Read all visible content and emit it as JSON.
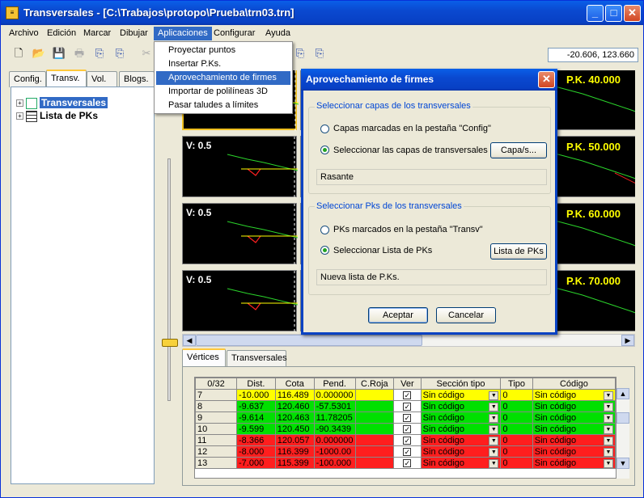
{
  "window": {
    "title": "Transversales - [C:\\Trabajos\\protopo\\Prueba\\trn03.trn]",
    "minimize_label": "_",
    "maximize_label": "□",
    "close_label": "✕",
    "app_icon": "≡"
  },
  "menubar": {
    "items": [
      "Archivo",
      "Edición",
      "Marcar",
      "Dibujar",
      "Aplicaciones",
      "Configurar",
      "Ayuda"
    ]
  },
  "toolbar": {
    "coordinates": "-20.606, 123.660"
  },
  "left_tabs": [
    "Config.",
    "Transv.",
    "Vol.",
    "Blogs."
  ],
  "tree": {
    "items": [
      "Transversales",
      "Lista de PKs"
    ],
    "expander": "+"
  },
  "graphs": {
    "rows": [
      {
        "v": "V: 0.5",
        "pk": "P.K. 40.000"
      },
      {
        "v": "V: 0.5",
        "pk": "P.K. 50.000"
      },
      {
        "v": "V: 0.5",
        "pk": "P.K. 60.000"
      },
      {
        "v": "V: 0.5",
        "pk": "P.K. 70.000"
      }
    ]
  },
  "bottom_tabs": [
    "Vértices",
    "Transversales"
  ],
  "grid": {
    "headers": [
      "0/32",
      "Dist.",
      "Cota",
      "Pend.",
      "C.Roja",
      "Ver",
      "Sección tipo",
      "Tipo",
      "Código"
    ],
    "check_mark": "✓",
    "rows": [
      {
        "n": "7",
        "dist": "-10.000",
        "cota": "116.489",
        "pend": "0.000000",
        "roja": "",
        "ver": true,
        "seccion": "Sin código",
        "tipo": "0",
        "codigo": "Sin código",
        "color": "#ffff00"
      },
      {
        "n": "8",
        "dist": "-9.637",
        "cota": "120.460",
        "pend": "-57.5301",
        "roja": "",
        "ver": true,
        "seccion": "Sin código",
        "tipo": "0",
        "codigo": "Sin código",
        "color": "#00e000"
      },
      {
        "n": "9",
        "dist": "-9.614",
        "cota": "120.463",
        "pend": "11.78205",
        "roja": "",
        "ver": true,
        "seccion": "Sin código",
        "tipo": "0",
        "codigo": "Sin código",
        "color": "#00e000"
      },
      {
        "n": "10",
        "dist": "-9.599",
        "cota": "120.450",
        "pend": "-90.3439",
        "roja": "",
        "ver": true,
        "seccion": "Sin código",
        "tipo": "0",
        "codigo": "Sin código",
        "color": "#00e000"
      },
      {
        "n": "11",
        "dist": "-8.366",
        "cota": "120.057",
        "pend": "0.000000",
        "roja": "",
        "ver": true,
        "seccion": "Sin código",
        "tipo": "0",
        "codigo": "Sin código",
        "color": "#ff1e1e"
      },
      {
        "n": "12",
        "dist": "-8.000",
        "cota": "116.399",
        "pend": "-1000.00",
        "roja": "",
        "ver": true,
        "seccion": "Sin código",
        "tipo": "0",
        "codigo": "Sin código",
        "color": "#ff1e1e"
      },
      {
        "n": "13",
        "dist": "-7.000",
        "cota": "115.399",
        "pend": "-100.000",
        "roja": "",
        "ver": true,
        "seccion": "Sin código",
        "tipo": "0",
        "codigo": "Sin código",
        "color": "#ff1e1e"
      }
    ]
  },
  "dropdown": {
    "items": [
      "Proyectar puntos",
      "Insertar P.Ks.",
      "Aprovechamiento de firmes",
      "Importar de polilíneas 3D",
      "Pasar taludes a límites"
    ],
    "highlighted_index": 2
  },
  "dialog": {
    "title": "Aprovechamiento de firmes",
    "group1": {
      "label": "Seleccionar capas de los transversales",
      "option1": "Capas marcadas en la pestaña \"Config\"",
      "option2": "Seleccionar las capas de transversales",
      "button": "Capa/s...",
      "field": "Rasante"
    },
    "group2": {
      "label": "Seleccionar Pks de los transversales",
      "option1": "PKs marcados en la pestaña \"Transv\"",
      "option2": "Seleccionar Lista de PKs",
      "button": "Lista de PKs",
      "field": "Nueva lista de P.Ks."
    },
    "ok": "Aceptar",
    "cancel": "Cancelar"
  },
  "colors": {
    "accent": "#316ac5",
    "titlebar": "#0a49d0",
    "profile_green": "#2bd42b",
    "profile_red": "#ff2020",
    "rasante_yellow": "#ffff00"
  }
}
